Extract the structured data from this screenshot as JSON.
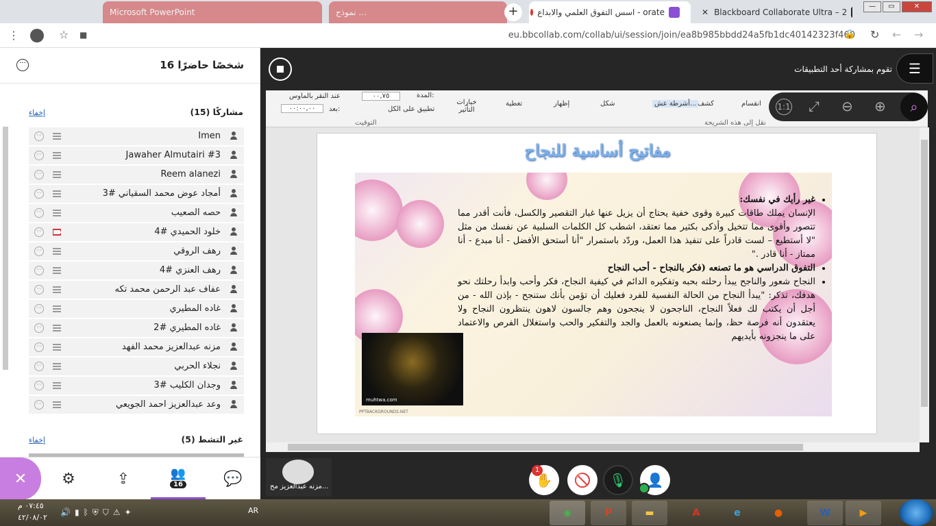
{
  "browser": {
    "tabs": [
      {
        "label": "Microsoft PowerPoint",
        "state": "dim"
      },
      {
        "label": "نموذج …",
        "state": "dim"
      },
      {
        "label": "orate - اسس التفوق العلمي والابداع",
        "state": "normal"
      },
      {
        "label": "Blackboard Collaborate Ultra – 2",
        "state": "active"
      }
    ],
    "url": "eu.bbcollab.com/collab/ui/session/join/ea8b985bbdd24a5fb1dc40142323f460"
  },
  "panel": {
    "title": "16 شخصًا حاضرًا",
    "participants_header": "مشاركًا (15)",
    "hide_label": "إخفاء",
    "participants": [
      {
        "name": "Imen",
        "cc": "normal"
      },
      {
        "name": "Jawaher Almutairi #3",
        "cc": "normal"
      },
      {
        "name": "Reem alanezi",
        "cc": "normal"
      },
      {
        "name": "أمجاد عوض محمد السقياني #3",
        "cc": "normal"
      },
      {
        "name": "حصه الصعيب",
        "cc": "normal"
      },
      {
        "name": "خلود الحميدي #4",
        "cc": "red"
      },
      {
        "name": "رهف الروقي",
        "cc": "normal"
      },
      {
        "name": "رهف العنزي #4",
        "cc": "normal"
      },
      {
        "name": "عفاف عبد الرحمن محمد تكه",
        "cc": "normal"
      },
      {
        "name": "غاده المطيري",
        "cc": "normal"
      },
      {
        "name": "غاده المطيري #2",
        "cc": "normal"
      },
      {
        "name": "مزنه عبدالعزيز محمد الفهد",
        "cc": "normal"
      },
      {
        "name": "نجلاء الحربي",
        "cc": "normal"
      },
      {
        "name": "وجدان الكليب #3",
        "cc": "normal"
      },
      {
        "name": "وعد عبدالعزيز احمد الجويعي",
        "cc": "normal"
      }
    ],
    "inactive_header": "غير التشط (5)",
    "inactive_hide_label": "إخفاء",
    "attendee_badge": "16"
  },
  "share": {
    "header": "تقوم بمشاركة أحد التطبيقات"
  },
  "ribbon": {
    "labels": [
      "انقسام",
      "كشف",
      "أشرطة عش...",
      "شكل",
      "إظهار",
      "تغطية"
    ],
    "timing_label": "التوقيت",
    "transition_label": "نقل إلى هذه الشريحة",
    "effect_options": "خيارات التأثير",
    "apply_all": "تطبيق على الكل",
    "duration_label": "المدة:",
    "duration_value": "٠٠,٧٥",
    "on_click": "عند النقر بالماوس",
    "after_label": "بعد:",
    "after_value": "٠٠:٠٠,٠٠"
  },
  "slide": {
    "title": "مفاتيح أساسية للنجاح",
    "bullet1_head": "غير رأيك في نفسك:",
    "bullet1_body": "الإنسان يملك طاقات كبيرة وقوى خفية يحتاج أن يزيل عنها غبار التقصير والكسل، فأنت أقدر مما تتصور وأقوى مما تتخيل وأذكى بكثير مما تعتقد، اشطب كل الكلمات السلبية عن نفسك من مثل \"لا أستطيع – لست قادراً على تنفيذ هذا العمل، وردّد باستمرار \"أنا أستحق الأفضل - أنا مبدع - أنا ممتاز - أنا قادر .\"",
    "bullet2": "التفوق الدراسي هو ما تصنعه (فكر بالنجاح - أحب النجاح",
    "bullet3": "النجاح شعور والناجح يبدأ رحلته بحبه وتفكيره الدائم في كيفية النجاح، فكر وأحب وابدأ رحلتك نحو هدفك، تذكر: \"يبدأ النجاح من الحالة النفسية للفرد فعليك أن تؤمن بأنك ستنجح - بإذن الله - من أجل أن يكتب لك فعلاً النجاح، الناجحون لا ينجحون وهم جالسون لاهون ينتظرون النجاح ولا يعتقدون أنه فرصة حظ، وإنما يصنعونه بالعمل والجد والتفكير والحب واستغلال الفرص والاعتماد على ما ينجزونه بأيديهم",
    "image_caption": "muhtwa.com",
    "footer": "PPTBACKGROUNDS.NET"
  },
  "media": {
    "own_name": "مزنه عبدالعزيز مح...",
    "hand_badge": "1"
  },
  "taskbar": {
    "lang": "AR",
    "time": "٠٧:٤٥ م",
    "date": "٤٢/٠٨/٠٢"
  }
}
